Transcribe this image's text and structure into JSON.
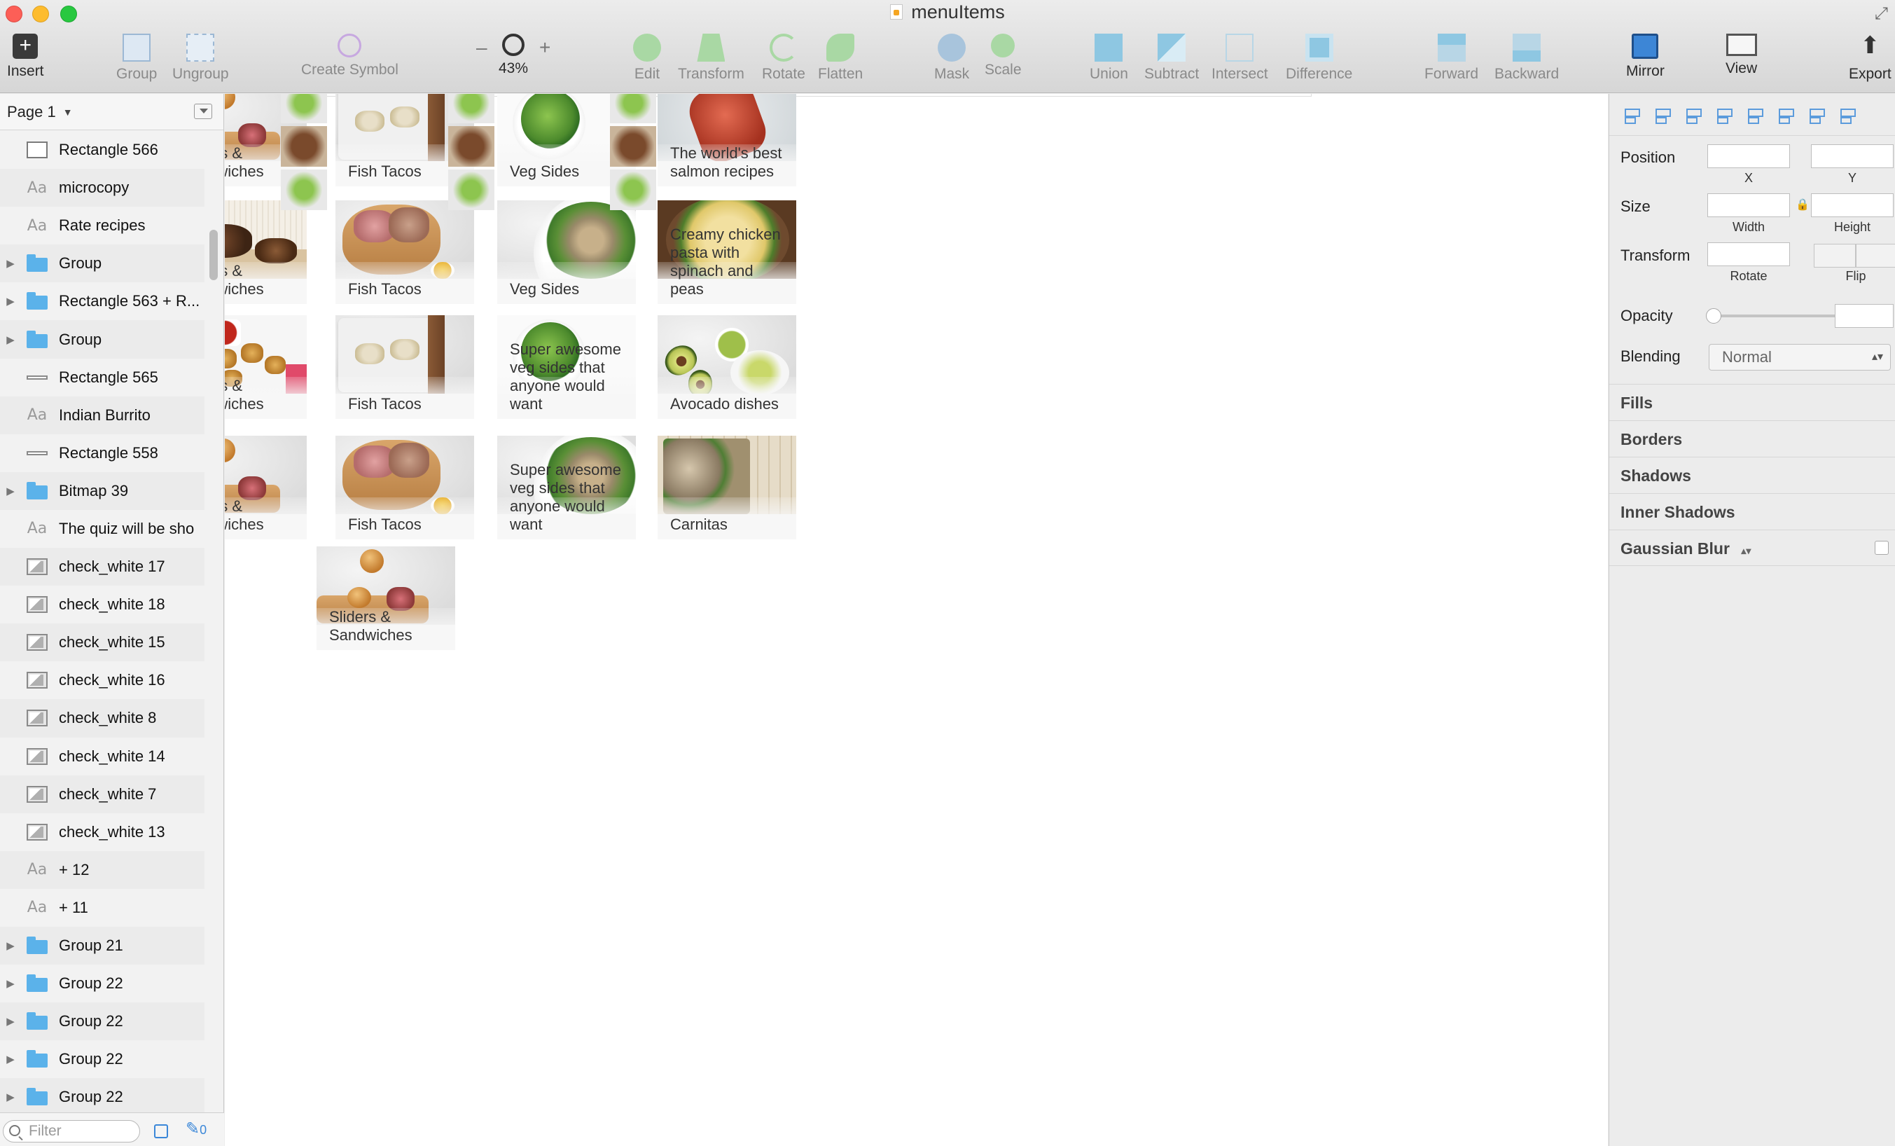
{
  "window": {
    "title": "menuItems"
  },
  "toolbar": {
    "insert": "Insert",
    "group": "Group",
    "ungroup": "Ungroup",
    "create_symbol": "Create Symbol",
    "zoom_minus": "–",
    "zoom_plus": "+",
    "zoom": "43%",
    "edit": "Edit",
    "transform": "Transform",
    "rotate": "Rotate",
    "flatten": "Flatten",
    "mask": "Mask",
    "scale": "Scale",
    "union": "Union",
    "subtract": "Subtract",
    "intersect": "Intersect",
    "difference": "Difference",
    "forward": "Forward",
    "backward": "Backward",
    "mirror": "Mirror",
    "view": "View",
    "export": "Export"
  },
  "layers_panel": {
    "page_label": "Page 1",
    "filter_placeholder": "Filter",
    "filter_count": "0",
    "items": [
      {
        "label": "Rectangle 566",
        "icon": "rectangle-icon",
        "disclosure": false
      },
      {
        "label": "microcopy",
        "icon": "text-icon",
        "disclosure": false
      },
      {
        "label": "Rate recipes",
        "icon": "text-icon",
        "disclosure": false
      },
      {
        "label": "Group",
        "icon": "folder-icon",
        "disclosure": true
      },
      {
        "label": "Rectangle 563 + R...",
        "icon": "folder-icon",
        "disclosure": true
      },
      {
        "label": "Group",
        "icon": "folder-icon",
        "disclosure": true
      },
      {
        "label": "Rectangle 565",
        "icon": "line-icon",
        "disclosure": false
      },
      {
        "label": "Indian Burrito",
        "icon": "text-icon",
        "disclosure": false
      },
      {
        "label": "Rectangle 558",
        "icon": "line-icon",
        "disclosure": false
      },
      {
        "label": "Bitmap 39",
        "icon": "folder-icon",
        "disclosure": true
      },
      {
        "label": "The quiz will be sho",
        "icon": "text-icon",
        "disclosure": false
      },
      {
        "label": "check_white 17",
        "icon": "bitmap-icon",
        "disclosure": false
      },
      {
        "label": "check_white 18",
        "icon": "bitmap-icon",
        "disclosure": false
      },
      {
        "label": "check_white 15",
        "icon": "bitmap-icon",
        "disclosure": false
      },
      {
        "label": "check_white 16",
        "icon": "bitmap-icon",
        "disclosure": false
      },
      {
        "label": "check_white 8",
        "icon": "bitmap-icon",
        "disclosure": false
      },
      {
        "label": "check_white 14",
        "icon": "bitmap-icon",
        "disclosure": false
      },
      {
        "label": "check_white 7",
        "icon": "bitmap-icon",
        "disclosure": false
      },
      {
        "label": "check_white 13",
        "icon": "bitmap-icon",
        "disclosure": false
      },
      {
        "label": "+ 12",
        "icon": "text-icon",
        "disclosure": false
      },
      {
        "label": "+ 11",
        "icon": "text-icon",
        "disclosure": false
      },
      {
        "label": "Group 21",
        "icon": "folder-icon",
        "disclosure": true
      },
      {
        "label": "Group 22",
        "icon": "folder-icon",
        "disclosure": true
      },
      {
        "label": "Group 22",
        "icon": "folder-icon",
        "disclosure": true
      },
      {
        "label": "Group 22",
        "icon": "folder-icon",
        "disclosure": true
      },
      {
        "label": "Group 22",
        "icon": "folder-icon",
        "disclosure": true
      }
    ]
  },
  "canvas": {
    "cards": [
      {
        "caption": "Sliders & Sandwiches",
        "photo": "sliders"
      },
      {
        "caption": "Fish Tacos",
        "photo": "tacos"
      },
      {
        "caption": "Veg Sides",
        "photo": "vegsides"
      },
      {
        "caption": "The world's best salmon recipes",
        "photo": "salmon"
      },
      {
        "caption": "Sliders & Sandwiches",
        "photo": "roast"
      },
      {
        "caption": "Fish Tacos",
        "photo": "tuna"
      },
      {
        "caption": "Veg Sides",
        "photo": "salad"
      },
      {
        "caption": "Creamy chicken pasta with spinach and peas",
        "photo": "pasta"
      },
      {
        "caption": "Sliders & Sandwiches",
        "photo": "nuggets"
      },
      {
        "caption": "Fish Tacos",
        "photo": "tacos"
      },
      {
        "caption": "Super awesome veg sides that anyone would want",
        "photo": "vegsides"
      },
      {
        "caption": "Avocado dishes",
        "photo": "avocado"
      },
      {
        "caption": "Sliders & Sandwiches",
        "photo": "sliders"
      },
      {
        "caption": "Fish Tacos",
        "photo": "tuna"
      },
      {
        "caption": "Super awesome veg sides that anyone would want",
        "photo": "salad"
      },
      {
        "caption": "Carnitas",
        "photo": "carnitas"
      },
      {
        "caption": "Sliders & Sandwiches",
        "photo": "sliders"
      }
    ]
  },
  "inspector": {
    "position_label": "Position",
    "x_label": "X",
    "y_label": "Y",
    "size_label": "Size",
    "width_label": "Width",
    "height_label": "Height",
    "transform_label": "Transform",
    "rotate_label": "Rotate",
    "flip_label": "Flip",
    "opacity_label": "Opacity",
    "blending_label": "Blending",
    "blending_value": "Normal",
    "fills": "Fills",
    "borders": "Borders",
    "shadows": "Shadows",
    "inner_shadows": "Inner Shadows",
    "gaussian_blur": "Gaussian Blur",
    "gaussian_blur_arrows": "▴▾"
  },
  "colors": {
    "accent": "#3b87d8",
    "folder": "#5bb2ea",
    "canvas_bg": "#ffffff",
    "panel_bg": "#f2f2f2"
  }
}
